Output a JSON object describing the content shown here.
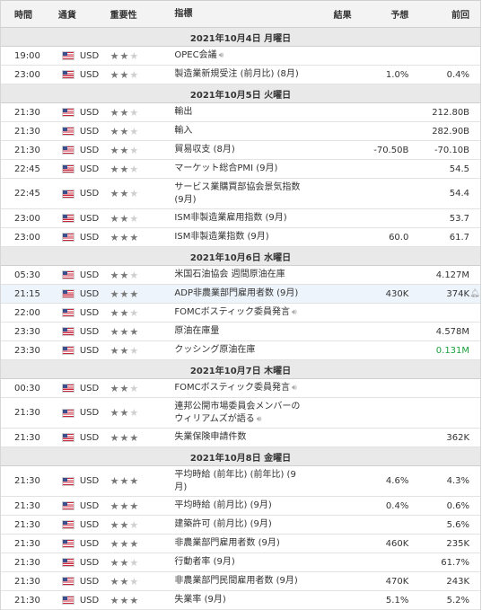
{
  "header": {
    "time": "時間",
    "currency": "通貨",
    "importance": "重要性",
    "indicator": "指標",
    "result": "結果",
    "forecast": "予想",
    "previous": "前回"
  },
  "groups": [
    {
      "date": "2021年10月4日 月曜日",
      "rows": [
        {
          "time": "19:00",
          "cur": "USD",
          "imp": 2,
          "ind": "OPEC会議",
          "speaker": true,
          "result": "",
          "forecast": "",
          "previous": ""
        },
        {
          "time": "23:00",
          "cur": "USD",
          "imp": 2,
          "ind": "製造業新規受注 (前月比) (8月)",
          "result": "",
          "forecast": "1.0%",
          "previous": "0.4%"
        }
      ]
    },
    {
      "date": "2021年10月5日 火曜日",
      "rows": [
        {
          "time": "21:30",
          "cur": "USD",
          "imp": 2,
          "ind": "輸出",
          "result": "",
          "forecast": "",
          "previous": "212.80B"
        },
        {
          "time": "21:30",
          "cur": "USD",
          "imp": 2,
          "ind": "輸入",
          "result": "",
          "forecast": "",
          "previous": "282.90B"
        },
        {
          "time": "21:30",
          "cur": "USD",
          "imp": 2,
          "ind": "貿易収支 (8月)",
          "result": "",
          "forecast": "-70.50B",
          "previous": "-70.10B"
        },
        {
          "time": "22:45",
          "cur": "USD",
          "imp": 2,
          "ind": "マーケット総合PMI (9月)",
          "result": "",
          "forecast": "",
          "previous": "54.5"
        },
        {
          "time": "22:45",
          "cur": "USD",
          "imp": 2,
          "ind": "サービス業購買部協会景気指数 (9月)",
          "result": "",
          "forecast": "",
          "previous": "54.4",
          "tall": true
        },
        {
          "time": "23:00",
          "cur": "USD",
          "imp": 2,
          "ind": "ISM非製造業雇用指数 (9月)",
          "result": "",
          "forecast": "",
          "previous": "53.7"
        },
        {
          "time": "23:00",
          "cur": "USD",
          "imp": 3,
          "ind": "ISM非製造業指数 (9月)",
          "result": "",
          "forecast": "60.0",
          "previous": "61.7"
        }
      ]
    },
    {
      "date": "2021年10月6日 水曜日",
      "rows": [
        {
          "time": "05:30",
          "cur": "USD",
          "imp": 2,
          "ind": "米国石油協会 週間原油在庫",
          "result": "",
          "forecast": "",
          "previous": "4.127M"
        },
        {
          "time": "21:15",
          "cur": "USD",
          "imp": 3,
          "ind": "ADP非農業部門雇用者数 (9月)",
          "result": "",
          "forecast": "430K",
          "previous": "374K",
          "highlight": true,
          "alert": true
        },
        {
          "time": "22:00",
          "cur": "USD",
          "imp": 2,
          "ind": "FOMCボスティック委員発言",
          "speaker": true,
          "result": "",
          "forecast": "",
          "previous": ""
        },
        {
          "time": "23:30",
          "cur": "USD",
          "imp": 3,
          "ind": "原油在庫量",
          "result": "",
          "forecast": "",
          "previous": "4.578M"
        },
        {
          "time": "23:30",
          "cur": "USD",
          "imp": 2,
          "ind": "クッシング原油在庫",
          "result": "",
          "forecast": "",
          "previous": "0.131M",
          "prevColor": "green"
        }
      ]
    },
    {
      "date": "2021年10月7日 木曜日",
      "rows": [
        {
          "time": "00:30",
          "cur": "USD",
          "imp": 2,
          "ind": "FOMCボスティック委員発言",
          "speaker": true,
          "result": "",
          "forecast": "",
          "previous": ""
        },
        {
          "time": "21:30",
          "cur": "USD",
          "imp": 2,
          "ind": "連邦公開市場委員会メンバーのウィリアムズが語る",
          "speaker": true,
          "result": "",
          "forecast": "",
          "previous": "",
          "tall": true
        },
        {
          "time": "21:30",
          "cur": "USD",
          "imp": 3,
          "ind": "失業保険申請件数",
          "result": "",
          "forecast": "",
          "previous": "362K"
        }
      ]
    },
    {
      "date": "2021年10月8日 金曜日",
      "rows": [
        {
          "time": "21:30",
          "cur": "USD",
          "imp": 3,
          "ind": "平均時給 (前年比) (前年比) (9月)",
          "result": "",
          "forecast": "4.6%",
          "previous": "4.3%",
          "tall": true
        },
        {
          "time": "21:30",
          "cur": "USD",
          "imp": 3,
          "ind": "平均時給 (前月比) (9月)",
          "result": "",
          "forecast": "0.4%",
          "previous": "0.6%"
        },
        {
          "time": "21:30",
          "cur": "USD",
          "imp": 2,
          "ind": "建築許可 (前月比) (9月)",
          "result": "",
          "forecast": "",
          "previous": "5.6%"
        },
        {
          "time": "21:30",
          "cur": "USD",
          "imp": 3,
          "ind": "非農業部門雇用者数 (9月)",
          "result": "",
          "forecast": "460K",
          "previous": "235K"
        },
        {
          "time": "21:30",
          "cur": "USD",
          "imp": 2,
          "ind": "行動者率 (9月)",
          "result": "",
          "forecast": "",
          "previous": "61.7%"
        },
        {
          "time": "21:30",
          "cur": "USD",
          "imp": 2,
          "ind": "非農業部門民間雇用者数 (9月)",
          "result": "",
          "forecast": "470K",
          "previous": "243K"
        },
        {
          "time": "21:30",
          "cur": "USD",
          "imp": 3,
          "ind": "失業率 (9月)",
          "result": "",
          "forecast": "5.1%",
          "previous": "5.2%"
        }
      ]
    }
  ],
  "icons": {
    "speaker": "speaker-icon",
    "alert": "bell-plus-icon",
    "flag": "us-flag-icon",
    "star": "star-icon"
  },
  "colors": {
    "positive": "#1aa03c"
  }
}
